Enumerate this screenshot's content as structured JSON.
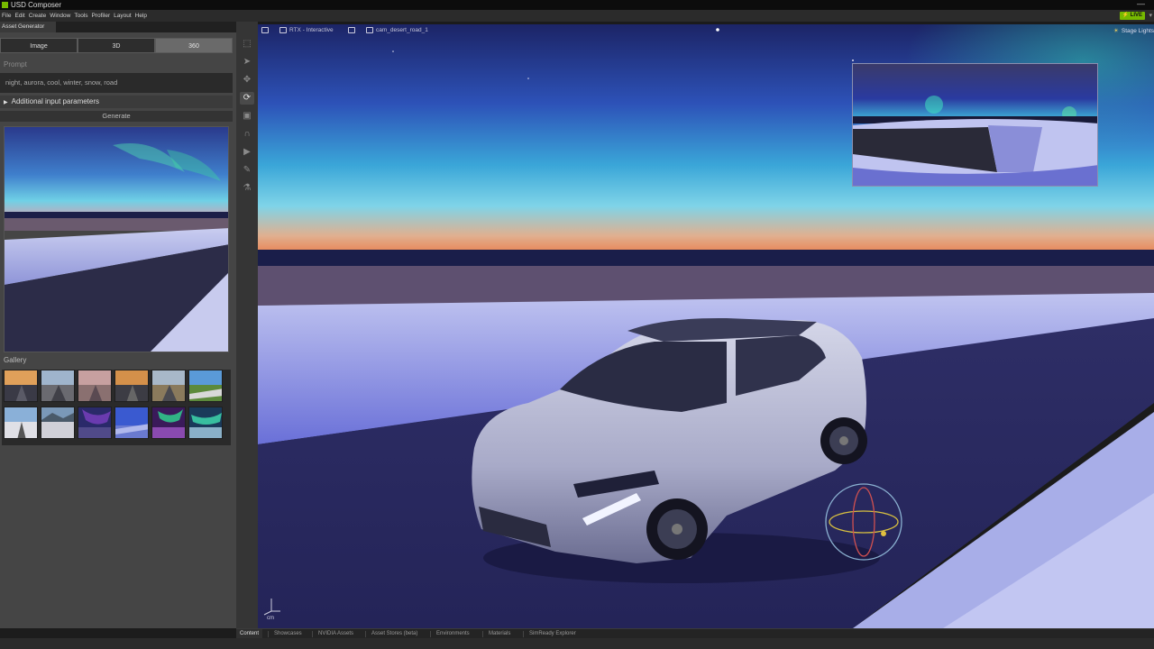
{
  "app": {
    "title": "USD Composer",
    "live_label": "LIVE"
  },
  "menu": [
    "File",
    "Edit",
    "Create",
    "Window",
    "Tools",
    "Profiler",
    "Layout",
    "Help"
  ],
  "panel": {
    "tab_label": "Asset Generator",
    "modes": [
      {
        "label": "Image",
        "active": false
      },
      {
        "label": "3D",
        "active": false
      },
      {
        "label": "360",
        "active": true
      }
    ],
    "prompt_label": "Prompt",
    "prompt_value": "night, aurora, cool, winter, snow, road",
    "params_label": "Additional input parameters",
    "generate_label": "Generate",
    "gallery_label": "Gallery",
    "gallery_count": 12
  },
  "viewport": {
    "renderer_label": "RTX - Interactive",
    "camera_label": "cam_desert_road_1",
    "stage_lights_label": "Stage Lights",
    "unit_label": "cm"
  },
  "bottom_tabs": [
    {
      "label": "Content",
      "active": true
    },
    {
      "label": "Showcases",
      "active": false
    },
    {
      "label": "NVIDIA Assets",
      "active": false
    },
    {
      "label": "Asset Stores (beta)",
      "active": false
    },
    {
      "label": "Environments",
      "active": false
    },
    {
      "label": "Materials",
      "active": false
    },
    {
      "label": "SimReady Explorer",
      "active": false
    }
  ],
  "colors": {
    "nvidia_green": "#76b900",
    "panel_bg": "#454545",
    "sky_top": "#1f2a78",
    "sky_horizon": "#4ab8e0",
    "snow": "#9aa0e8",
    "road": "#2a2a5a"
  }
}
